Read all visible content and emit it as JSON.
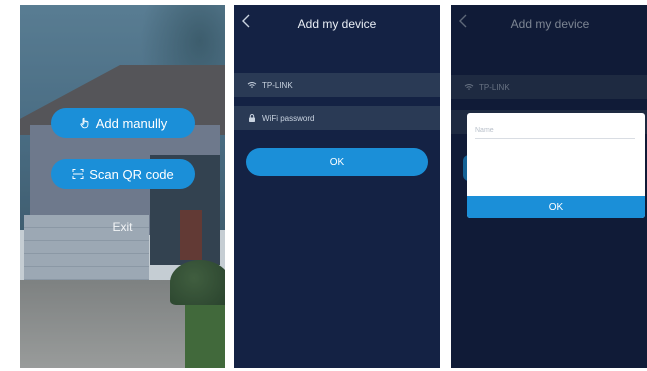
{
  "screen1": {
    "add_label": "Add manully",
    "scan_label": "Scan QR code",
    "exit_label": "Exit"
  },
  "screen2": {
    "title": "Add my device",
    "wifi_name": "TP-LINK",
    "password_placeholder": "WiFi password",
    "ok_label": "OK"
  },
  "screen3": {
    "title": "Add my device",
    "wifi_name": "TP-LINK",
    "name_placeholder": "Name",
    "ok_label": "OK"
  },
  "colors": {
    "accent": "#1b8fd8",
    "dark_bg": "#142244",
    "row_bg": "#2a3a55"
  }
}
